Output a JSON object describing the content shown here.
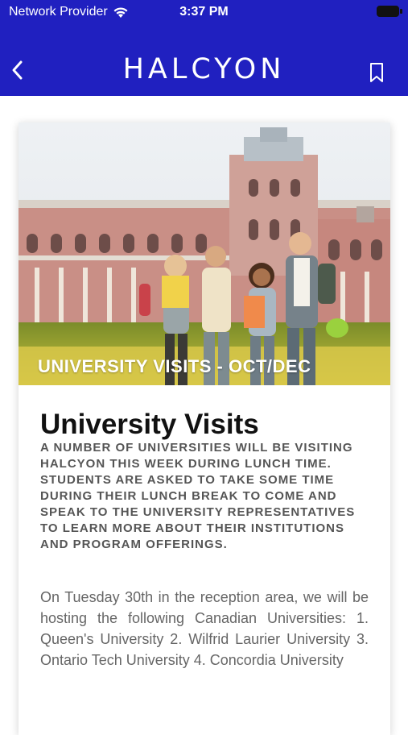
{
  "status_bar": {
    "carrier": "Network Provider",
    "time": "3:37 PM"
  },
  "nav": {
    "title": "HALCYON",
    "back_icon": "chevron-left-icon",
    "bookmark_icon": "bookmark-icon"
  },
  "colors": {
    "header_bg": "#2020c0",
    "caption_text": "#ffffff"
  },
  "article": {
    "image_caption": "UNIVERSITY VISITS - OCT/DEC",
    "title": "University Visits",
    "lead": "A NUMBER OF UNIVERSITIES WILL BE VISITING HALCYON THIS WEEK DURING LUNCH TIME. STUDENTS ARE ASKED TO TAKE SOME TIME DURING THEIR LUNCH BREAK TO COME AND SPEAK TO THE UNIVERSITY REPRESENTATIVES TO LEARN MORE ABOUT THEIR INSTITUTIONS AND PROGRAM OFFERINGS.",
    "body": "On Tuesday 30th in the reception area, we will be hosting the following Canadian Universities: 1. Queen's University 2. Wilfrid Laurier University 3. Ontario Tech University 4. Concordia University"
  }
}
